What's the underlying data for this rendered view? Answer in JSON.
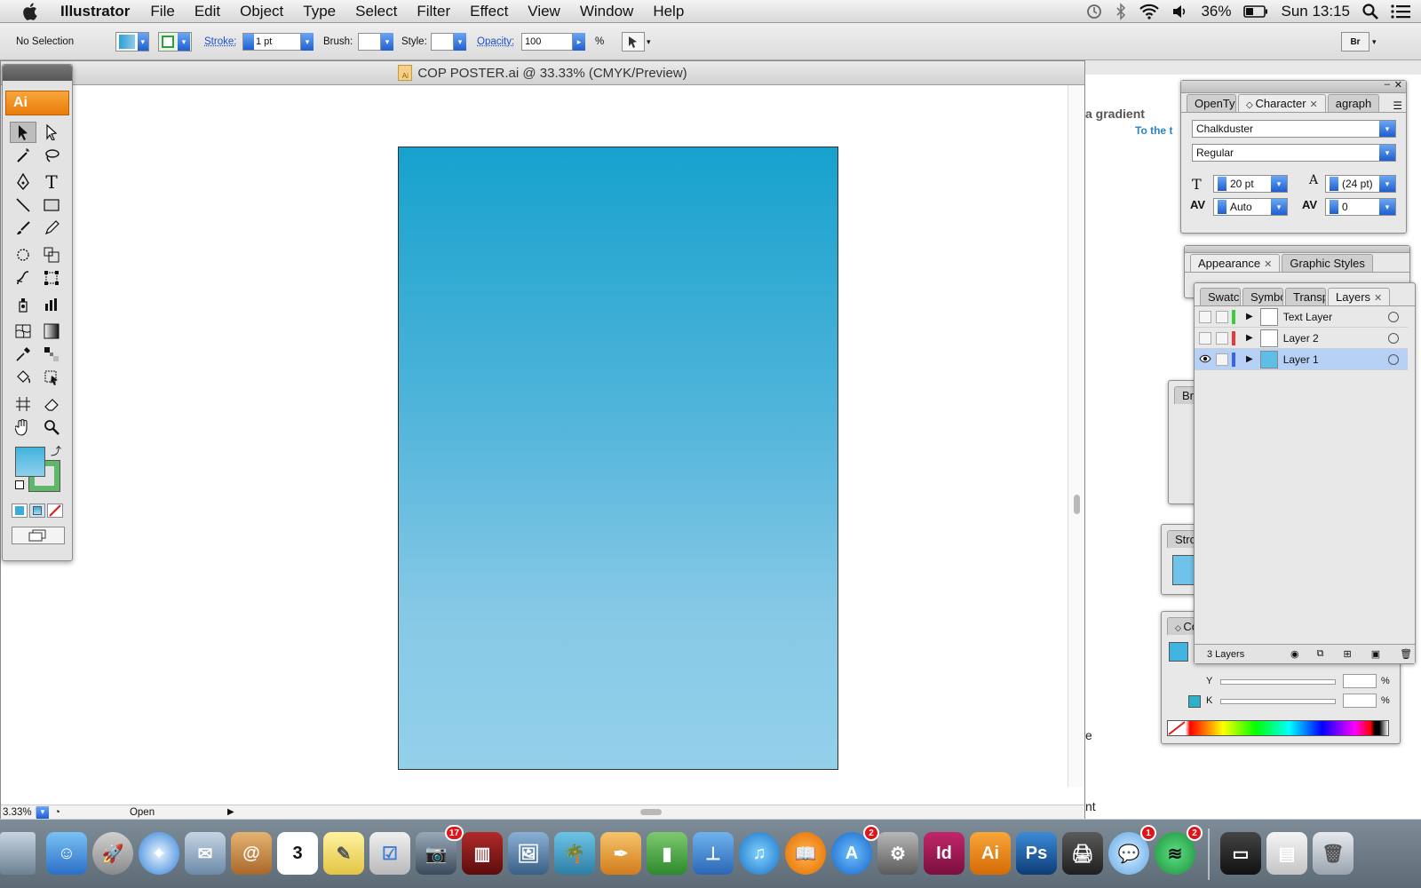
{
  "menubar": {
    "app_name": "Illustrator",
    "items": [
      "File",
      "Edit",
      "Object",
      "Type",
      "Select",
      "Filter",
      "Effect",
      "View",
      "Window",
      "Help"
    ],
    "battery": "36%",
    "clock": "Sun 13:15"
  },
  "control_bar": {
    "selection_label": "No Selection",
    "stroke_label": "Stroke:",
    "stroke_value": "1 pt",
    "brush_label": "Brush:",
    "style_label": "Style:",
    "opacity_label": "Opacity:",
    "opacity_value": "100",
    "percent": "%"
  },
  "document": {
    "title": "COP POSTER.ai @ 33.33% (CMYK/Preview)",
    "zoom": "3.33%",
    "status": "Open",
    "artboard_gradient": [
      "#16a2cd",
      "#93d0ea"
    ]
  },
  "toolbox": {
    "badge": "Ai"
  },
  "background_doc": {
    "text_gradient": "a gradient",
    "text_link": "To the t",
    "text_e": "e",
    "text_nt": "nt"
  },
  "character_panel": {
    "tabs": [
      {
        "label": "OpenTy"
      },
      {
        "label": "Character"
      },
      {
        "label": "agraph"
      }
    ],
    "font": "Chalkduster",
    "style": "Regular",
    "size": "20 pt",
    "leading": "(24 pt)",
    "kerning": "Auto",
    "tracking": "0"
  },
  "appearance_panel": {
    "tabs": [
      {
        "label": "Appearance"
      },
      {
        "label": "Graphic Styles"
      }
    ]
  },
  "layers_panel": {
    "tabs": [
      {
        "label": "Swatch"
      },
      {
        "label": "Symbo"
      },
      {
        "label": "Transp"
      },
      {
        "label": "Layers"
      }
    ],
    "layers": [
      {
        "name": "Text Layer",
        "color": "#3ccc3c",
        "visible": false
      },
      {
        "name": "Layer 2",
        "color": "#e83838",
        "visible": false
      },
      {
        "name": "Layer 1",
        "color": "#3a62e6",
        "visible": true
      }
    ],
    "count": "3 Layers"
  },
  "stacked_panels": {
    "brushes": "Br",
    "stroke": "Stro",
    "color": "Co",
    "y_label": "Y",
    "k_label": "K",
    "percent": "%"
  },
  "dock": {
    "badges": {
      "facetime": "17",
      "appstore": "2",
      "messages": "1",
      "spotify": "2"
    },
    "calendar_day": "3",
    "indesign": "Id",
    "illustrator": "Ai",
    "photoshop": "Ps"
  }
}
